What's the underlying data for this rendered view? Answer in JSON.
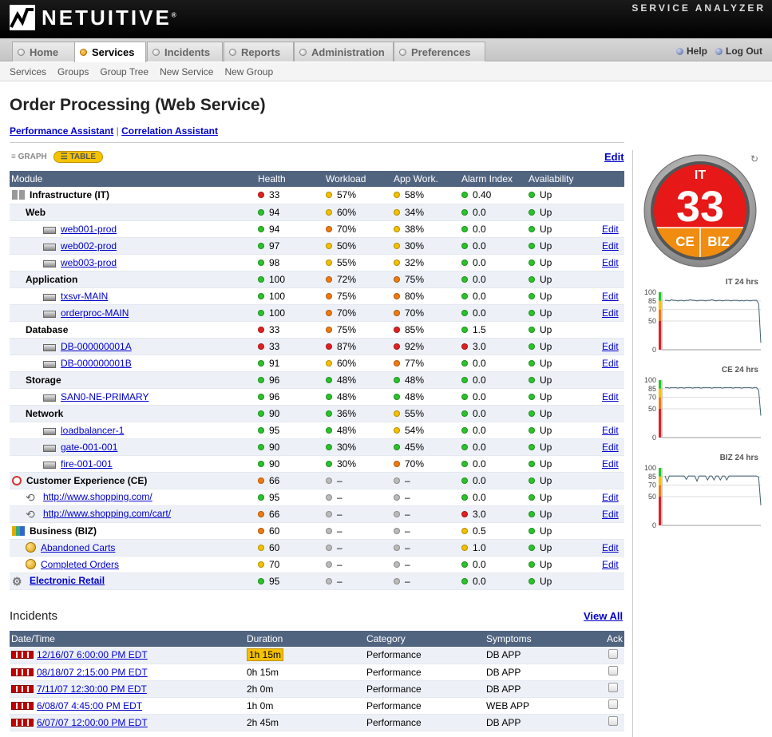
{
  "brand": {
    "name": "NETUITIVE",
    "reg": "®",
    "product": "SERVICE ANALYZER"
  },
  "tabs": [
    "Home",
    "Services",
    "Incidents",
    "Reports",
    "Administration",
    "Preferences"
  ],
  "active_tab": "Services",
  "header_links": {
    "help": "Help",
    "logout": "Log Out"
  },
  "subnav": [
    "Services",
    "Groups",
    "Group Tree",
    "New Service",
    "New Group"
  ],
  "page_title": "Order Processing (Web Service)",
  "assist": {
    "perf": "Performance Assistant",
    "sep": "|",
    "corr": "Correlation Assistant"
  },
  "view": {
    "graph": "GRAPH",
    "table": "TABLE",
    "edit": "Edit"
  },
  "columns": [
    "Module",
    "Health",
    "Workload",
    "App Work.",
    "Alarm Index",
    "Availability",
    ""
  ],
  "rows": [
    {
      "name": "Infrastructure (IT)",
      "lvl": 0,
      "icon": "infrastructure-icon",
      "bold": true,
      "link": false,
      "h": [
        "red",
        "33"
      ],
      "w": [
        "yellow",
        "57%"
      ],
      "a": [
        "yellow",
        "58%"
      ],
      "al": [
        "green",
        "0.40"
      ],
      "av": [
        "green",
        "Up"
      ],
      "edit": ""
    },
    {
      "name": "Web",
      "lvl": 1,
      "icon": "",
      "bold": true,
      "link": false,
      "h": [
        "green",
        "94"
      ],
      "w": [
        "yellow",
        "60%"
      ],
      "a": [
        "yellow",
        "34%"
      ],
      "al": [
        "green",
        "0.0"
      ],
      "av": [
        "green",
        "Up"
      ],
      "edit": ""
    },
    {
      "name": "web001-prod",
      "lvl": 2,
      "icon": "server-icon",
      "bold": false,
      "link": true,
      "h": [
        "green",
        "94"
      ],
      "w": [
        "orange",
        "70%"
      ],
      "a": [
        "yellow",
        "38%"
      ],
      "al": [
        "green",
        "0.0"
      ],
      "av": [
        "green",
        "Up"
      ],
      "edit": "Edit"
    },
    {
      "name": "web002-prod",
      "lvl": 2,
      "icon": "server-icon",
      "bold": false,
      "link": true,
      "h": [
        "green",
        "97"
      ],
      "w": [
        "yellow",
        "50%"
      ],
      "a": [
        "yellow",
        "30%"
      ],
      "al": [
        "green",
        "0.0"
      ],
      "av": [
        "green",
        "Up"
      ],
      "edit": "Edit"
    },
    {
      "name": "web003-prod",
      "lvl": 2,
      "icon": "server-icon",
      "bold": false,
      "link": true,
      "h": [
        "green",
        "98"
      ],
      "w": [
        "yellow",
        "55%"
      ],
      "a": [
        "yellow",
        "32%"
      ],
      "al": [
        "green",
        "0.0"
      ],
      "av": [
        "green",
        "Up"
      ],
      "edit": "Edit"
    },
    {
      "name": "Application",
      "lvl": 1,
      "icon": "",
      "bold": true,
      "link": false,
      "h": [
        "green",
        "100"
      ],
      "w": [
        "orange",
        "72%"
      ],
      "a": [
        "orange",
        "75%"
      ],
      "al": [
        "green",
        "0.0"
      ],
      "av": [
        "green",
        "Up"
      ],
      "edit": ""
    },
    {
      "name": "txsvr-MAIN",
      "lvl": 2,
      "icon": "server-icon",
      "bold": false,
      "link": true,
      "h": [
        "green",
        "100"
      ],
      "w": [
        "orange",
        "75%"
      ],
      "a": [
        "orange",
        "80%"
      ],
      "al": [
        "green",
        "0.0"
      ],
      "av": [
        "green",
        "Up"
      ],
      "edit": "Edit"
    },
    {
      "name": "orderproc-MAIN",
      "lvl": 2,
      "icon": "server-icon",
      "bold": false,
      "link": true,
      "h": [
        "green",
        "100"
      ],
      "w": [
        "orange",
        "70%"
      ],
      "a": [
        "orange",
        "70%"
      ],
      "al": [
        "green",
        "0.0"
      ],
      "av": [
        "green",
        "Up"
      ],
      "edit": "Edit"
    },
    {
      "name": "Database",
      "lvl": 1,
      "icon": "",
      "bold": true,
      "link": false,
      "h": [
        "red",
        "33"
      ],
      "w": [
        "orange",
        "75%"
      ],
      "a": [
        "red",
        "85%"
      ],
      "al": [
        "green",
        "1.5"
      ],
      "av": [
        "green",
        "Up"
      ],
      "edit": ""
    },
    {
      "name": "DB-000000001A",
      "lvl": 2,
      "icon": "server-icon",
      "bold": false,
      "link": true,
      "h": [
        "red",
        "33"
      ],
      "w": [
        "red",
        "87%"
      ],
      "a": [
        "red",
        "92%"
      ],
      "al": [
        "red",
        "3.0"
      ],
      "av": [
        "green",
        "Up"
      ],
      "edit": "Edit"
    },
    {
      "name": "DB-000000001B",
      "lvl": 2,
      "icon": "server-icon",
      "bold": false,
      "link": true,
      "h": [
        "green",
        "91"
      ],
      "w": [
        "yellow",
        "60%"
      ],
      "a": [
        "orange",
        "77%"
      ],
      "al": [
        "green",
        "0.0"
      ],
      "av": [
        "green",
        "Up"
      ],
      "edit": "Edit"
    },
    {
      "name": "Storage",
      "lvl": 1,
      "icon": "",
      "bold": true,
      "link": false,
      "h": [
        "green",
        "96"
      ],
      "w": [
        "green",
        "48%"
      ],
      "a": [
        "green",
        "48%"
      ],
      "al": [
        "green",
        "0.0"
      ],
      "av": [
        "green",
        "Up"
      ],
      "edit": ""
    },
    {
      "name": "SAN0-NE-PRIMARY",
      "lvl": 2,
      "icon": "server-icon",
      "bold": false,
      "link": true,
      "h": [
        "green",
        "96"
      ],
      "w": [
        "green",
        "48%"
      ],
      "a": [
        "green",
        "48%"
      ],
      "al": [
        "green",
        "0.0"
      ],
      "av": [
        "green",
        "Up"
      ],
      "edit": "Edit"
    },
    {
      "name": "Network",
      "lvl": 1,
      "icon": "",
      "bold": true,
      "link": false,
      "h": [
        "green",
        "90"
      ],
      "w": [
        "green",
        "36%"
      ],
      "a": [
        "yellow",
        "55%"
      ],
      "al": [
        "green",
        "0.0"
      ],
      "av": [
        "green",
        "Up"
      ],
      "edit": ""
    },
    {
      "name": "loadbalancer-1",
      "lvl": 2,
      "icon": "server-icon",
      "bold": false,
      "link": true,
      "h": [
        "green",
        "95"
      ],
      "w": [
        "green",
        "48%"
      ],
      "a": [
        "yellow",
        "54%"
      ],
      "al": [
        "green",
        "0.0"
      ],
      "av": [
        "green",
        "Up"
      ],
      "edit": "Edit"
    },
    {
      "name": "gate-001-001",
      "lvl": 2,
      "icon": "server-icon",
      "bold": false,
      "link": true,
      "h": [
        "green",
        "90"
      ],
      "w": [
        "green",
        "30%"
      ],
      "a": [
        "green",
        "45%"
      ],
      "al": [
        "green",
        "0.0"
      ],
      "av": [
        "green",
        "Up"
      ],
      "edit": "Edit"
    },
    {
      "name": "fire-001-001",
      "lvl": 2,
      "icon": "server-icon",
      "bold": false,
      "link": true,
      "h": [
        "green",
        "90"
      ],
      "w": [
        "green",
        "30%"
      ],
      "a": [
        "orange",
        "70%"
      ],
      "al": [
        "green",
        "0.0"
      ],
      "av": [
        "green",
        "Up"
      ],
      "edit": "Edit"
    },
    {
      "name": "Customer Experience (CE)",
      "lvl": 0,
      "icon": "clock-icon",
      "bold": true,
      "link": false,
      "h": [
        "orange",
        "66"
      ],
      "w": [
        "gray",
        "–"
      ],
      "a": [
        "gray",
        "–"
      ],
      "al": [
        "green",
        "0.0"
      ],
      "av": [
        "green",
        "Up"
      ],
      "edit": ""
    },
    {
      "name": "http://www.shopping.com/",
      "lvl": 1,
      "icon": "url-icon",
      "bold": false,
      "link": true,
      "h": [
        "green",
        "95"
      ],
      "w": [
        "gray",
        "–"
      ],
      "a": [
        "gray",
        "–"
      ],
      "al": [
        "green",
        "0.0"
      ],
      "av": [
        "green",
        "Up"
      ],
      "edit": "Edit"
    },
    {
      "name": "http://www.shopping.com/cart/",
      "lvl": 1,
      "icon": "url-icon",
      "bold": false,
      "link": true,
      "h": [
        "orange",
        "66"
      ],
      "w": [
        "gray",
        "–"
      ],
      "a": [
        "gray",
        "–"
      ],
      "al": [
        "red",
        "3.0"
      ],
      "av": [
        "green",
        "Up"
      ],
      "edit": "Edit"
    },
    {
      "name": "Business (BIZ)",
      "lvl": 0,
      "icon": "business-icon",
      "bold": true,
      "link": false,
      "h": [
        "orange",
        "60"
      ],
      "w": [
        "gray",
        "–"
      ],
      "a": [
        "gray",
        "–"
      ],
      "al": [
        "yellow",
        "0.5"
      ],
      "av": [
        "green",
        "Up"
      ],
      "edit": ""
    },
    {
      "name": "Abandoned Carts",
      "lvl": 1,
      "icon": "coin-icon",
      "bold": false,
      "link": true,
      "h": [
        "yellow",
        "60"
      ],
      "w": [
        "gray",
        "–"
      ],
      "a": [
        "gray",
        "–"
      ],
      "al": [
        "yellow",
        "1.0"
      ],
      "av": [
        "green",
        "Up"
      ],
      "edit": "Edit"
    },
    {
      "name": "Completed Orders",
      "lvl": 1,
      "icon": "coin-icon",
      "bold": false,
      "link": true,
      "h": [
        "yellow",
        "70"
      ],
      "w": [
        "gray",
        "–"
      ],
      "a": [
        "gray",
        "–"
      ],
      "al": [
        "green",
        "0.0"
      ],
      "av": [
        "green",
        "Up"
      ],
      "edit": "Edit"
    },
    {
      "name": "Electronic Retail",
      "lvl": 0,
      "icon": "gear-icon",
      "bold": true,
      "link": true,
      "h": [
        "green",
        "95"
      ],
      "w": [
        "gray",
        "–"
      ],
      "a": [
        "gray",
        "–"
      ],
      "al": [
        "green",
        "0.0"
      ],
      "av": [
        "green",
        "Up"
      ],
      "edit": ""
    }
  ],
  "incidents": {
    "title": "Incidents",
    "view_all": "View All",
    "columns": [
      "Date/Time",
      "Duration",
      "Category",
      "Symptoms",
      "Ack"
    ],
    "rows": [
      {
        "date": "12/16/07 6:00:00 PM EDT",
        "duration": "1h 15m",
        "highlight": true,
        "category": "Performance",
        "symptoms": "DB APP"
      },
      {
        "date": "08/18/07 2:15:00 PM EDT",
        "duration": "0h 15m",
        "highlight": false,
        "category": "Performance",
        "symptoms": "DB APP"
      },
      {
        "date": "7/11/07 12:30:00 PM EDT",
        "duration": "2h 0m",
        "highlight": false,
        "category": "Performance",
        "symptoms": "DB APP"
      },
      {
        "date": "6/08/07 4:45:00 PM EDT",
        "duration": "1h 0m",
        "highlight": false,
        "category": "Performance",
        "symptoms": "WEB APP"
      },
      {
        "date": "6/07/07 12:00:00 PM EDT",
        "duration": "2h 45m",
        "highlight": false,
        "category": "Performance",
        "symptoms": "DB APP"
      }
    ]
  },
  "gauge": {
    "top_label": "IT",
    "value": "33",
    "left_label": "CE",
    "right_label": "BIZ"
  },
  "sparklines": [
    {
      "title": "IT 24 hrs",
      "ticks": [
        "100",
        "85",
        "70",
        "50",
        "0"
      ],
      "values": [
        86,
        86,
        85,
        87,
        86,
        86,
        85,
        86,
        86,
        85,
        86,
        86,
        87,
        86,
        86,
        85,
        86,
        86,
        86,
        85,
        86,
        86,
        87,
        86,
        85,
        86,
        86,
        85,
        86,
        86,
        86,
        85,
        86,
        86,
        86,
        85,
        86,
        85,
        86,
        86,
        85,
        86,
        86,
        86,
        80,
        12
      ]
    },
    {
      "title": "CE 24 hrs",
      "ticks": [
        "100",
        "85",
        "70",
        "50",
        "0"
      ],
      "values": [
        87,
        87,
        86,
        87,
        87,
        87,
        86,
        87,
        87,
        86,
        87,
        87,
        87,
        86,
        87,
        87,
        87,
        86,
        87,
        87,
        87,
        87,
        86,
        87,
        87,
        87,
        87,
        86,
        87,
        87,
        87,
        87,
        86,
        87,
        87,
        87,
        86,
        87,
        87,
        87,
        87,
        86,
        87,
        87,
        82,
        38
      ]
    },
    {
      "title": "BIZ 24 hrs",
      "ticks": [
        "100",
        "85",
        "70",
        "50",
        "0"
      ],
      "values": [
        86,
        76,
        86,
        86,
        86,
        86,
        86,
        86,
        86,
        86,
        80,
        86,
        86,
        86,
        86,
        77,
        86,
        86,
        86,
        86,
        79,
        86,
        86,
        79,
        86,
        86,
        79,
        86,
        86,
        79,
        86,
        86,
        86,
        86,
        86,
        86,
        86,
        86,
        86,
        86,
        86,
        86,
        86,
        86,
        84,
        35
      ]
    }
  ],
  "colors": {
    "green": "#2bc22b",
    "red": "#e02020",
    "yellow": "#f5c000",
    "orange": "#f07a10",
    "header_bg": "#506480"
  }
}
